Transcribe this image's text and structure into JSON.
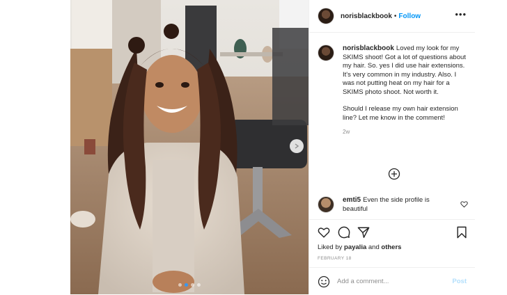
{
  "header": {
    "username": "norisblackbook",
    "separator": "•",
    "follow_label": "Follow",
    "more_icon": "more-options-icon"
  },
  "caption": {
    "username": "norisblackbook",
    "text": "Loved my look for my SKIMS shoot! Got a lot of questions about my hair. So. yes I did use hair extensions. It's very common in my industry. Also. I was not putting heat on my hair for a SKIMS photo shoot. Not worth it.",
    "text2": "Should I release my own hair extension line? Let me know in the comment!",
    "time": "2w"
  },
  "load_more_icon": "plus-circle-icon",
  "comment": {
    "username": "emti5",
    "text": "Even the side profile is beautiful"
  },
  "actions": {
    "liked_prefix": "Liked by",
    "liked_user": "payalia",
    "liked_and": "and",
    "liked_others": "others",
    "date": "FEBRUARY 18"
  },
  "add_comment": {
    "placeholder": "Add a comment...",
    "post_label": "Post"
  },
  "carousel": {
    "slide_count": 4,
    "active_index": 1
  },
  "colors": {
    "accent": "#0095f6",
    "post_disabled": "#b2dffc",
    "muted": "#8e8e8e"
  }
}
